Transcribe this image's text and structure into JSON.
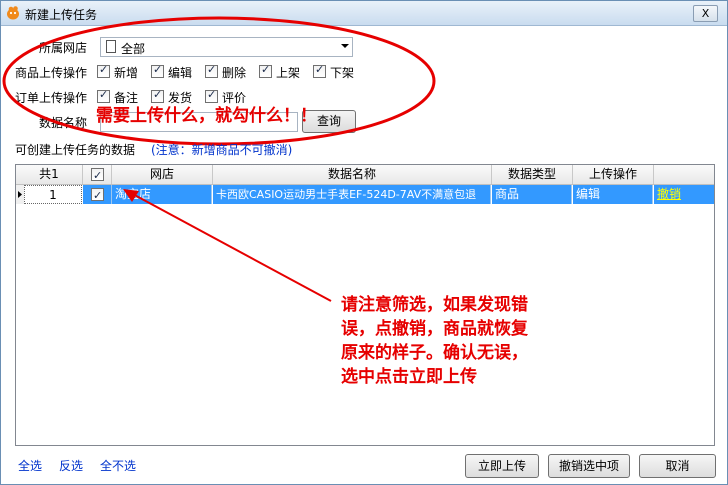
{
  "window": {
    "title": "新建上传任务",
    "close_label": "X"
  },
  "form": {
    "shop_label": "所属网店",
    "shop_value": "全部",
    "product_ops_label": "商品上传操作",
    "product_ops": [
      "新增",
      "编辑",
      "删除",
      "上架",
      "下架"
    ],
    "order_ops_label": "订单上传操作",
    "order_ops": [
      "备注",
      "发货",
      "评价"
    ],
    "data_name_label": "数据名称",
    "data_name_value": "",
    "query_button": "查询",
    "creatable_label": "可创建上传任务的数据",
    "note": "(注意：新增商品不可撤消)"
  },
  "annotations": {
    "top": "需要上传什么，就勾什么！！",
    "bottom": [
      "请注意筛选，如果发现错",
      "误，点撤销，商品就恢复",
      "原来的样子。确认无误，",
      "选中点击立即上传"
    ],
    "color": "#e60000",
    "ellipse_color": "#e60000"
  },
  "table": {
    "count_header": "共1",
    "headers": [
      "网店",
      "数据名称",
      "数据类型",
      "上传操作"
    ],
    "rows": [
      {
        "index": "1",
        "shop": "淘宝店",
        "name": "卡西欧CASIO运动男士手表EF-524D-7AV不满意包退",
        "type": "商品",
        "op": "编辑",
        "action": "撤销"
      }
    ]
  },
  "bottom": {
    "select_all": "全选",
    "invert": "反选",
    "select_none": "全不选",
    "upload_now": "立即上传",
    "cancel_selected": "撤销选中项",
    "cancel": "取消"
  },
  "colors": {
    "selection": "#3399ff",
    "link": "#0033cc",
    "action_link": "#ffff00"
  }
}
